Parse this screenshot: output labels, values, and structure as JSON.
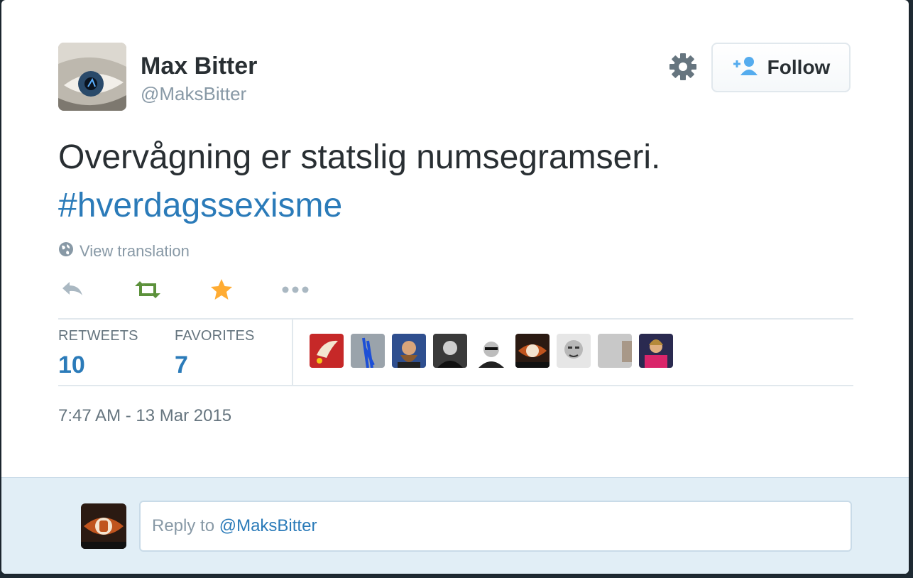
{
  "user": {
    "name": "Max Bitter",
    "handle": "@MaksBitter"
  },
  "header": {
    "follow_label": "Follow"
  },
  "tweet": {
    "text": "Overvågning er statslig numsegramseri.",
    "hashtag": "#hverdagssexisme",
    "view_translation": "View translation",
    "timestamp": "7:47 AM - 13 Mar 2015"
  },
  "actions": [
    {
      "icon": "reply-icon",
      "color": "#aab8c2"
    },
    {
      "icon": "retweet-icon",
      "color": "#5c913b"
    },
    {
      "icon": "favorite-star-icon",
      "color": "#ffac33"
    },
    {
      "icon": "more-dots-icon",
      "color": "#aab8c2"
    }
  ],
  "stats": {
    "retweets_label": "RETWEETS",
    "retweets_value": "10",
    "favorites_label": "FAVORITES",
    "favorites_value": "7"
  },
  "favoriters": [
    {
      "name": "favoriter-avatar-1"
    },
    {
      "name": "favoriter-avatar-2"
    },
    {
      "name": "favoriter-avatar-3"
    },
    {
      "name": "favoriter-avatar-4"
    },
    {
      "name": "favoriter-avatar-5"
    },
    {
      "name": "favoriter-avatar-6"
    },
    {
      "name": "favoriter-avatar-7"
    },
    {
      "name": "favoriter-avatar-8"
    },
    {
      "name": "favoriter-avatar-9"
    }
  ],
  "reply": {
    "prefix": "Reply to ",
    "mention": "@MaksBitter"
  },
  "colors": {
    "link": "#2b7bb9",
    "text": "#292f33",
    "muted": "#8899a6",
    "reply_bg": "#e1eef6"
  }
}
